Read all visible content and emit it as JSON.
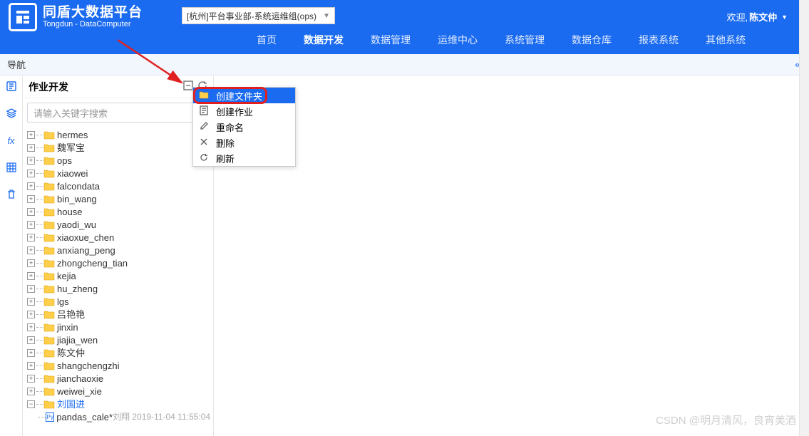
{
  "header": {
    "brand_cn": "同盾大数据平台",
    "brand_en": "Tongdun - DataComputer",
    "org_selected": "[杭州]平台事业部-系统运维组(ops)",
    "welcome_prefix": "欢迎,",
    "username": "陈文仲"
  },
  "nav": {
    "items": [
      "首页",
      "数据开发",
      "数据管理",
      "运维中心",
      "系统管理",
      "数据仓库",
      "报表系统",
      "其他系统"
    ],
    "active_index": 1
  },
  "navhdr": {
    "title": "导航",
    "collapse_glyph": "«"
  },
  "sidebar": {
    "title": "作业开发",
    "search_placeholder": "请输入关键字搜索",
    "folders": [
      "hermes",
      "魏军宝",
      "ops",
      "xiaowei",
      "falcondata",
      "bin_wang",
      "house",
      "yaodi_wu",
      "xiaoxue_chen",
      "anxiang_peng",
      "zhongcheng_tian",
      "kejia",
      "hu_zheng",
      "lgs",
      "吕艳艳",
      "jinxin",
      "jiajia_wen",
      "陈文仲",
      "shangchengzhi",
      "jianchaoxie",
      "weiwei_xie"
    ],
    "special": {
      "name": "刘国进",
      "file": "pandas_cale*",
      "meta": "刘翔 2019-11-04 11:55:04"
    }
  },
  "context_menu": {
    "items": [
      {
        "icon": "folder",
        "label": "创建文件夹",
        "selected": true
      },
      {
        "icon": "doc",
        "label": "创建作业"
      },
      {
        "icon": "rename",
        "label": "重命名"
      },
      {
        "icon": "delete",
        "label": "删除"
      },
      {
        "icon": "refresh",
        "label": "刷新"
      }
    ]
  },
  "watermark": "CSDN @明月清风，良宵美酒"
}
